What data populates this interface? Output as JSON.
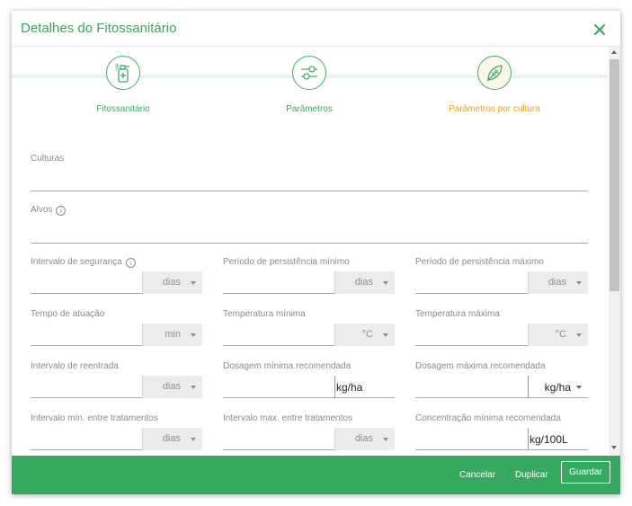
{
  "dialog": {
    "title": "Detalhes do Fitossanitário",
    "close_icon": "close-icon"
  },
  "stepper": {
    "steps": [
      {
        "label": "Fitossanitário",
        "icon": "spray-bottle-icon",
        "active": false
      },
      {
        "label": "Parâmetros",
        "icon": "sliders-icon",
        "active": false
      },
      {
        "label": "Parâmetros por cultura",
        "icon": "leaf-icon",
        "active": true
      }
    ]
  },
  "fields": {
    "culturas": {
      "label": "Culturas",
      "value": ""
    },
    "alvos": {
      "label": "Alvos",
      "value": ""
    },
    "intervalo_seguranca": {
      "label": "Intervalo de segurança",
      "unit": "dias"
    },
    "persistencia_minimo": {
      "label": "Período de persistência mínimo",
      "unit": "dias"
    },
    "persistencia_maximo": {
      "label": "Período de persistência máximo",
      "unit": "dias"
    },
    "tempo_atuacao": {
      "label": "Tempo de atuação",
      "unit": "min"
    },
    "temperatura_minima": {
      "label": "Temperatura mínima",
      "unit": "°C"
    },
    "temperatura_maxima": {
      "label": "Temperatura máxima",
      "unit": "°C"
    },
    "intervalo_reentrada": {
      "label": "Intervalo de reentrada",
      "unit": "dias"
    },
    "dosagem_minima": {
      "label": "Dosagem mínima recomendada",
      "unit": "kg/ha"
    },
    "dosagem_maxima": {
      "label": "Dosagem máxima recomendada",
      "unit": "kg/ha"
    },
    "intervalo_min_tratamentos": {
      "label": "Intervalo mín. entre tratamentos",
      "unit": "dias"
    },
    "intervalo_max_tratamentos": {
      "label": "Intervalo max. entre tratamentos",
      "unit": "dias"
    },
    "concentracao_minima": {
      "label": "Concentração mínima recomendada",
      "unit": "kg/100L"
    }
  },
  "footer": {
    "cancel_label": "Cancelar",
    "duplicate_label": "Duplicar",
    "save_label": "Guardar"
  },
  "colors": {
    "accent_green": "#37a85f",
    "active_step_orange": "#f0a30a"
  }
}
